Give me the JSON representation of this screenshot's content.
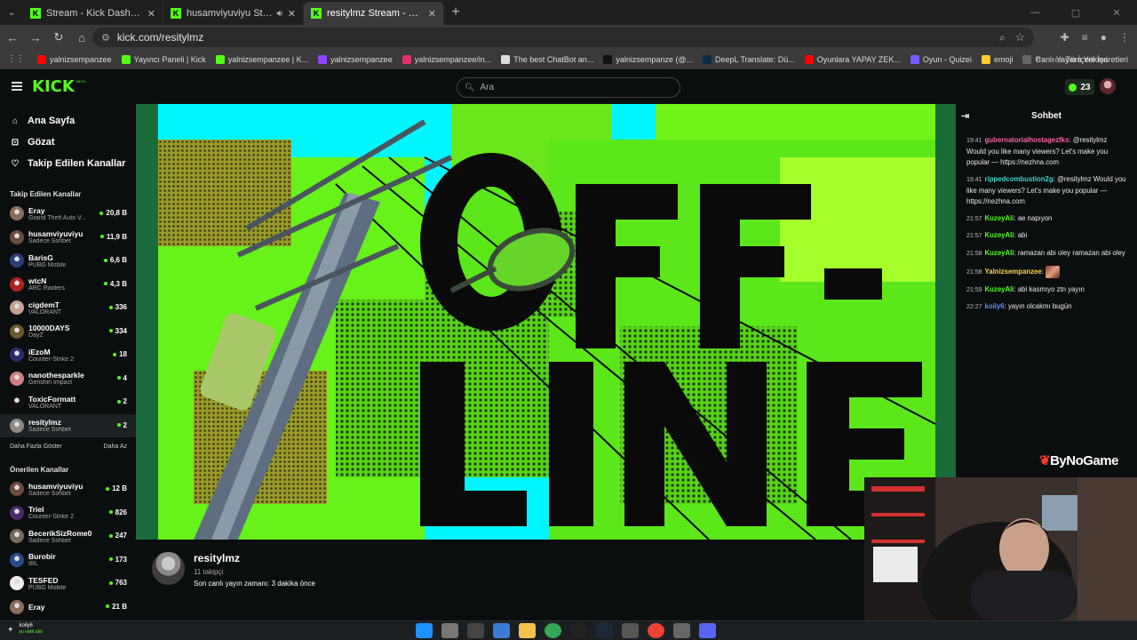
{
  "browser": {
    "tabs": [
      {
        "title": "Stream - Kick Dashboard",
        "active": false,
        "audio": false
      },
      {
        "title": "husamviyuviyu Stream - Wa",
        "active": false,
        "audio": true
      },
      {
        "title": "resitylmz Stream - Watch Live o",
        "active": true,
        "audio": false
      }
    ],
    "url": "kick.com/resitylmz",
    "bookmarks": [
      {
        "label": "yalnizsempanzee",
        "color": "#ff0000"
      },
      {
        "label": "Yayıncı Paneli | Kick",
        "color": "#53fc18"
      },
      {
        "label": "yalnizsempanzee | K...",
        "color": "#53fc18"
      },
      {
        "label": "yalnizsempanzee",
        "color": "#9146ff"
      },
      {
        "label": "yalnizsempanzee/in...",
        "color": "#e1306c"
      },
      {
        "label": "The best ChatBot an...",
        "color": "#dddddd"
      },
      {
        "label": "yalnizsempanze (@...",
        "color": "#111111"
      },
      {
        "label": "DeepL Translate: Dü...",
        "color": "#0f2b46"
      },
      {
        "label": "Oyunlara YAPAY ZEK...",
        "color": "#ff0000"
      },
      {
        "label": "Oyun - Quizei",
        "color": "#7a5cff"
      },
      {
        "label": "emoji",
        "color": "#ffcc33"
      },
      {
        "label": "Canlı Yayın İçerikleri",
        "color": "#666666"
      }
    ],
    "bookmarks_all": "Tüm Yer İşaretleri"
  },
  "header": {
    "logo": "KICK",
    "beta": "BETA",
    "search_placeholder": "Ara",
    "coins": "23"
  },
  "sidebar": {
    "nav": [
      {
        "icon": "home-icon",
        "glyph": "⌂",
        "label": "Ana Sayfa"
      },
      {
        "icon": "compass-icon",
        "glyph": "⊡",
        "label": "Gözat"
      },
      {
        "icon": "heart-icon",
        "glyph": "♡",
        "label": "Takip Edilen Kanallar"
      }
    ],
    "followed_title": "Takip Edilen Kanallar",
    "followed": [
      {
        "name": "Eray",
        "category": "Grand Theft Auto V...",
        "viewers": "20,8 B",
        "color": "#8b6d5c"
      },
      {
        "name": "husamviyuviyu",
        "category": "Sadece Sohbet",
        "viewers": "11,9 B",
        "color": "#6b4b3b"
      },
      {
        "name": "BarisG",
        "category": "PUBG Mobile",
        "viewers": "6,6 B",
        "color": "#2b3d7a"
      },
      {
        "name": "wtcN",
        "category": "ARC Raiders",
        "viewers": "4,3 B",
        "color": "#b02020"
      },
      {
        "name": "cigdemT",
        "category": "VALORANT",
        "viewers": "336",
        "color": "#c8a090"
      },
      {
        "name": "10000DAYS",
        "category": "DayZ",
        "viewers": "334",
        "color": "#6b5a2b"
      },
      {
        "name": "iEzoM",
        "category": "Counter-Strike 2",
        "viewers": "18",
        "color": "#2a2a6a"
      },
      {
        "name": "nanothesparkle",
        "category": "Genshin Impact",
        "viewers": "4",
        "color": "#d08080"
      },
      {
        "name": "ToxicFormatt",
        "category": "VALORANT",
        "viewers": "2",
        "color": "#101010"
      },
      {
        "name": "resitylmz",
        "category": "Sadece Sohbet",
        "viewers": "2",
        "color": "#8a8a8a"
      }
    ],
    "show_more": "Daha Fazla Göster",
    "show_less": "Daha Az",
    "recommended_title": "Önerilen Kanallar",
    "recommended": [
      {
        "name": "husamviyuviyu",
        "category": "Sadece Sohbet",
        "viewers": "12 B",
        "color": "#6b4b3b"
      },
      {
        "name": "Triel",
        "category": "Counter-Strike 2",
        "viewers": "826",
        "color": "#4a2a6a"
      },
      {
        "name": "BecerikSizRome0",
        "category": "Sadece Sohbet",
        "viewers": "247",
        "color": "#7a6a5a"
      },
      {
        "name": "Burobir",
        "category": "IRL",
        "viewers": "173",
        "color": "#2a4a8a"
      },
      {
        "name": "TESFED",
        "category": "PUBG Mobile",
        "viewers": "763",
        "color": "#eeeeee"
      },
      {
        "name": "Eray",
        "category": "",
        "viewers": "21 B",
        "color": "#8b6d5c"
      }
    ]
  },
  "player": {
    "offline_line1": "OFF-",
    "offline_line2": "LINE"
  },
  "channel": {
    "name": "resitylmz",
    "followers": "11 takipçi",
    "last_live": "Son canlı yayın zamanı: 3 dakika önce"
  },
  "chat": {
    "title": "Sohbet",
    "messages": [
      {
        "time": "19:41",
        "user": "gubernatorialhostagezfks",
        "color": "#ff5fa2",
        "text": "@resitylmz Would you like many viewers? Let's make you popular — https://nezhna.com"
      },
      {
        "time": "19:41",
        "user": "rippedcombustion2g",
        "color": "#3fd4c8",
        "text": "@resitylmz Would you like many viewers? Let's make you popular — https://nezhna.com"
      },
      {
        "time": "21:57",
        "user": "KuzeyAli",
        "color": "#53fc18",
        "text": "ae napıyon"
      },
      {
        "time": "21:57",
        "user": "KuzeyAli",
        "color": "#53fc18",
        "text": "abi"
      },
      {
        "time": "21:58",
        "user": "KuzeyAli",
        "color": "#53fc18",
        "text": "ramazan abi oley ramazan abi oley"
      },
      {
        "time": "21:58",
        "user": "Yalnizsempanzee",
        "color": "#ffd23f",
        "text": "",
        "emote": true
      },
      {
        "time": "21:59",
        "user": "KuzeyAli",
        "color": "#53fc18",
        "text": "abi kasmıyo ztn yayın"
      },
      {
        "time": "22:27",
        "user": "koily6",
        "color": "#5c8dff",
        "text": "yayın olcakmı bugün"
      }
    ]
  },
  "overlay": {
    "brand": "ByNoGame"
  },
  "taskbar": {
    "user": "koily6",
    "status": "şu vakit aldı"
  }
}
